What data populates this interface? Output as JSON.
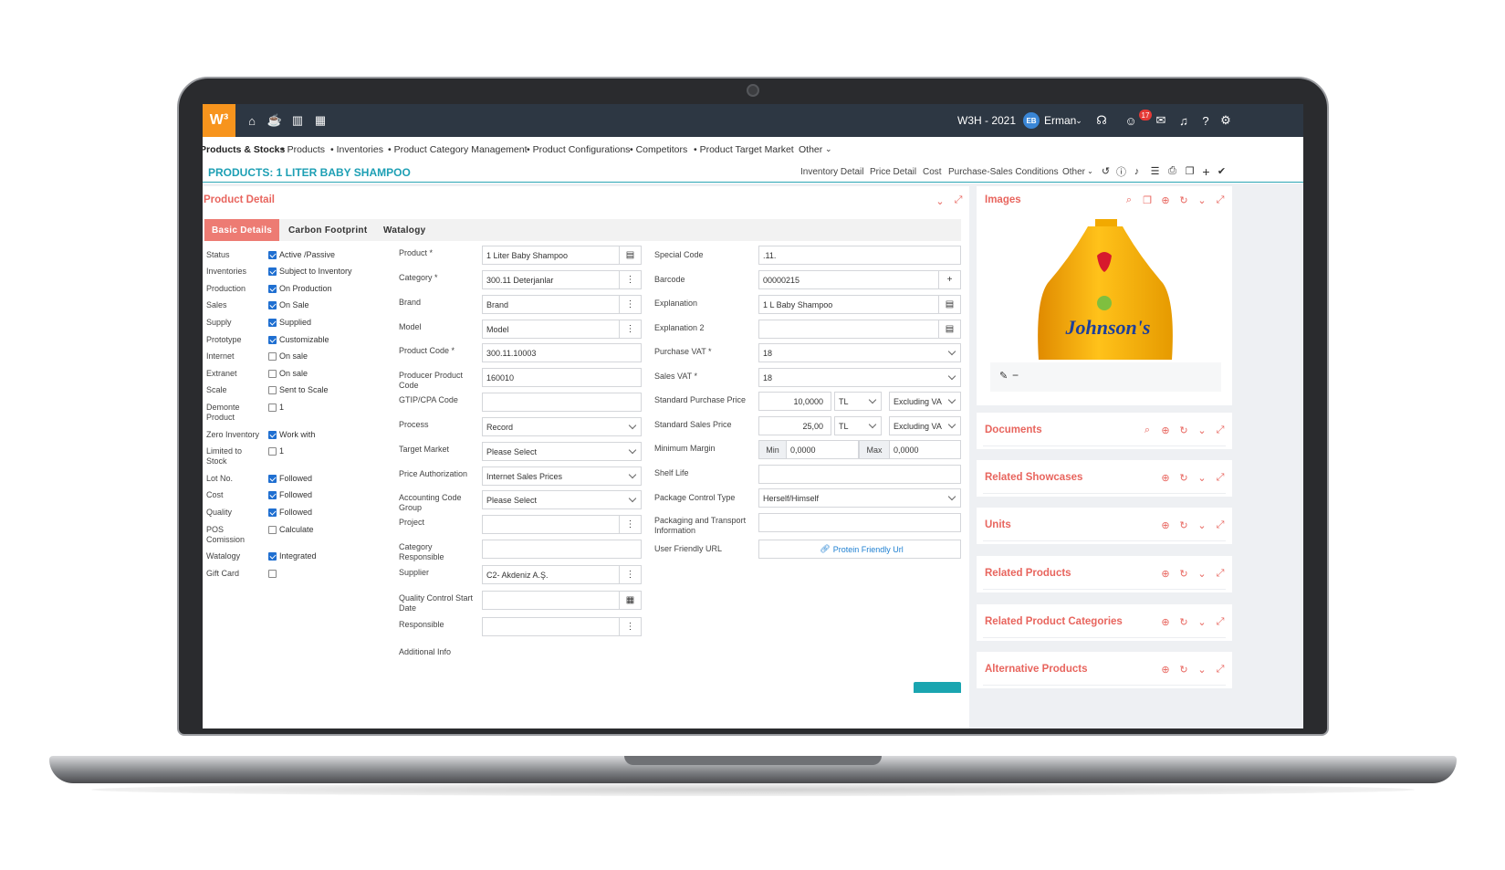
{
  "topbar": {
    "logo": "W³",
    "company": "W3H - 2021",
    "avatar_initials": "EB",
    "user": "Erman",
    "notifications_count": "17"
  },
  "breadcrumb": {
    "items": [
      "Products & Stocks",
      "• Products",
      "• Inventories",
      "• Product Category Management",
      "• Product Configurations",
      "• Competitors",
      "• Product Target Market",
      "Other"
    ]
  },
  "title_bar": {
    "title": "PRODUCTS: 1 LITER BABY SHAMPOO",
    "links": [
      "Inventory Detail",
      "Price Detail",
      "Cost",
      "Purchase-Sales Conditions",
      "Other"
    ]
  },
  "product_detail": {
    "title": "Product Detail",
    "tabs": [
      "Basic Details",
      "Carbon Footprint",
      "Watalogy"
    ],
    "flags": [
      {
        "label": "Status",
        "value": "Active /Passive",
        "checked": true
      },
      {
        "label": "Inventories",
        "value": "Subject to Inventory",
        "checked": true
      },
      {
        "label": "Production",
        "value": "On Production",
        "checked": true
      },
      {
        "label": "Sales",
        "value": "On Sale",
        "checked": true
      },
      {
        "label": "Supply",
        "value": "Supplied",
        "checked": true
      },
      {
        "label": "Prototype",
        "value": "Customizable",
        "checked": true
      },
      {
        "label": "Internet",
        "value": "On sale",
        "checked": false
      },
      {
        "label": "Extranet",
        "value": "On sale",
        "checked": false
      },
      {
        "label": "Scale",
        "value": "Sent to Scale",
        "checked": false
      },
      {
        "label": "Demonte Product",
        "value": "1",
        "checked": false
      },
      {
        "label": "Zero Inventory",
        "value": "Work with",
        "checked": true
      },
      {
        "label": "Limited to Stock",
        "value": "1",
        "checked": false
      },
      {
        "label": "Lot No.",
        "value": "Followed",
        "checked": true
      },
      {
        "label": "Cost",
        "value": "Followed",
        "checked": true
      },
      {
        "label": "Quality",
        "value": "Followed",
        "checked": true
      },
      {
        "label": "POS Comission",
        "value": "Calculate",
        "checked": false
      },
      {
        "label": "Watalogy",
        "value": "Integrated",
        "checked": true
      },
      {
        "label": "Gift Card",
        "value": "",
        "checked": false
      }
    ],
    "middle_fields": [
      {
        "label": "Product *",
        "value": "1 Liter Baby Shampoo",
        "suffix": "book"
      },
      {
        "label": "Category *",
        "value": "300.11 Deterjanlar",
        "suffix": "dots"
      },
      {
        "label": "Brand",
        "value": "Brand",
        "suffix": "dots"
      },
      {
        "label": "Model",
        "value": "Model",
        "suffix": "dots"
      },
      {
        "label": "Product Code *",
        "value": "300.11.10003",
        "suffix": ""
      },
      {
        "label": "Producer Product Code",
        "value": "160010",
        "suffix": ""
      },
      {
        "label": "GTIP/CPA Code",
        "value": "",
        "suffix": ""
      },
      {
        "label": "Process",
        "value": "Record",
        "suffix": "caret"
      },
      {
        "label": "Target Market",
        "value": "Please Select",
        "suffix": "caret"
      },
      {
        "label": "Price Authorization",
        "value": "Internet Sales Prices",
        "suffix": "caret"
      },
      {
        "label": "Accounting Code Group",
        "value": "Please Select",
        "suffix": "caret"
      },
      {
        "label": "Project",
        "value": "",
        "suffix": "dots"
      },
      {
        "label": "Category Responsible",
        "value": "",
        "suffix": ""
      },
      {
        "label": "Supplier",
        "value": "C2- Akdeniz A.Ş.",
        "suffix": "dots"
      },
      {
        "label": "Quality Control Start Date",
        "value": "",
        "suffix": "calendar"
      },
      {
        "label": "Responsible",
        "value": "",
        "suffix": "dots"
      },
      {
        "label": "Additional Info",
        "value": null,
        "suffix": ""
      }
    ],
    "right_fields": {
      "special_code_label": "Special Code",
      "special_code": ".11.",
      "barcode_label": "Barcode",
      "barcode": "00000215",
      "explanation_label": "Explanation",
      "explanation": "1 L Baby Shampoo",
      "explanation2_label": "Explanation 2",
      "explanation2": "",
      "purchase_vat_label": "Purchase VAT *",
      "purchase_vat": "18",
      "sales_vat_label": "Sales VAT *",
      "sales_vat": "18",
      "std_purchase_label": "Standard Purchase Price",
      "std_purchase": "10,0000",
      "std_purchase_cur": "TL",
      "std_purchase_tax": "Excluding VA",
      "std_sales_label": "Standard Sales Price",
      "std_sales": "25,00",
      "std_sales_cur": "TL",
      "std_sales_tax": "Excluding VA",
      "min_margin_label": "Minimum Margin",
      "min_label": "Min",
      "min_value": "0,0000",
      "max_label": "Max",
      "max_value": "0,0000",
      "shelf_life_label": "Shelf Life",
      "shelf_life": "",
      "package_control_label": "Package Control Type",
      "package_control": "Herself/Himself",
      "packaging_info_label": "Packaging and Transport Information",
      "packaging_info": "",
      "friendly_url_label": "User Friendly URL",
      "friendly_url": "Protein Friendly Url"
    }
  },
  "sidebar": {
    "images_title": "Images",
    "brand_text": "Johnson's",
    "cards": [
      "Documents",
      "Related Showcases",
      "Units",
      "Related Products",
      "Related Product Categories",
      "Alternative Products"
    ]
  },
  "colors": {
    "accent_orange": "#f7941d",
    "topbar": "#2d3743",
    "teal": "#1d9fb4",
    "salmon": "#e8655e"
  }
}
